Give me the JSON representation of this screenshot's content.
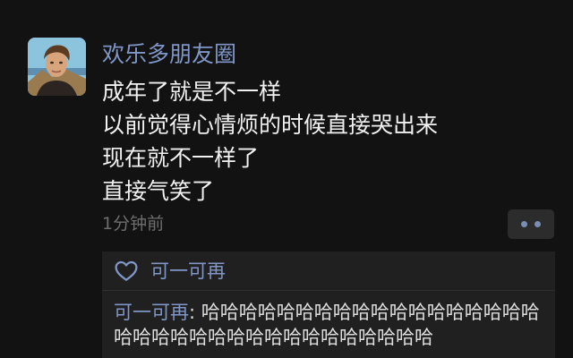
{
  "post": {
    "username": "欢乐多朋友圈",
    "lines": [
      "成年了就是不一样",
      "以前觉得心情烦的时候直接哭出来",
      "现在就不一样了",
      "直接气笑了"
    ],
    "timestamp": "1分钟前",
    "more_icon": "ellipsis-icon"
  },
  "interactions": {
    "like_icon": "heart-outline-icon",
    "likes": [
      "可一可再"
    ],
    "comments": [
      {
        "author": "可一可再",
        "separator": ": ",
        "text": "哈哈哈哈哈哈哈哈哈哈哈哈哈哈哈哈哈哈哈哈哈哈哈哈哈哈哈哈哈哈哈哈哈哈哈"
      }
    ]
  },
  "colors": {
    "background": "#121212",
    "name_blue": "#7f96c6",
    "text_primary": "#f1f1f1",
    "text_secondary": "#6e6e6e",
    "panel": "#202020"
  }
}
